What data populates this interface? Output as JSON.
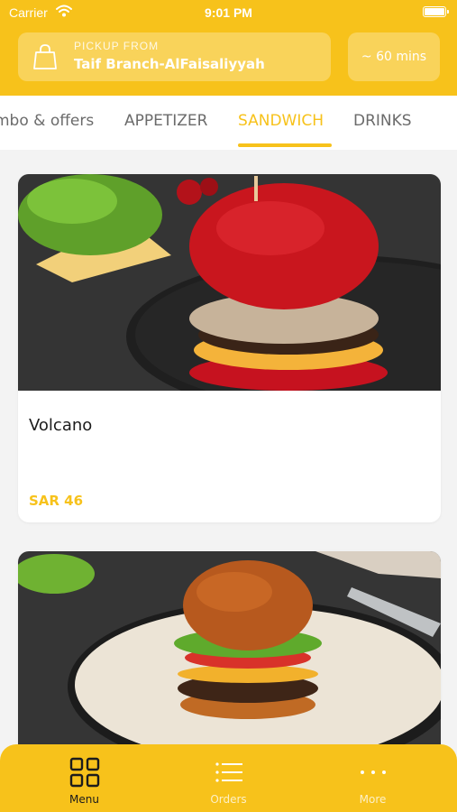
{
  "status_bar": {
    "carrier": "Carrier",
    "time": "9:01 PM"
  },
  "header": {
    "pickup_label": "PICKUP FROM",
    "branch_name": "Taif Branch-AlFaisaliyyah",
    "eta": "~ 60 mins"
  },
  "tabs": [
    {
      "label": "mbo & offers"
    },
    {
      "label": "APPETIZER"
    },
    {
      "label": "SANDWICH"
    },
    {
      "label": "DRINKS"
    }
  ],
  "active_tab": "SANDWICH",
  "products": [
    {
      "name": "Volcano",
      "price": "SAR 46",
      "image": "red-bun-burger-photo"
    },
    {
      "name": "",
      "price": "",
      "image": "classic-burger-photo"
    }
  ],
  "bottom_nav": [
    {
      "label": "Menu",
      "icon": "grid-icon",
      "active": true
    },
    {
      "label": "Orders",
      "icon": "list-icon",
      "active": false
    },
    {
      "label": "More",
      "icon": "dots-icon",
      "active": false
    }
  ],
  "colors": {
    "brand": "#f7c21b",
    "text": "#1c1c1c",
    "muted": "#6b6b6b",
    "background": "#f3f3f3"
  }
}
